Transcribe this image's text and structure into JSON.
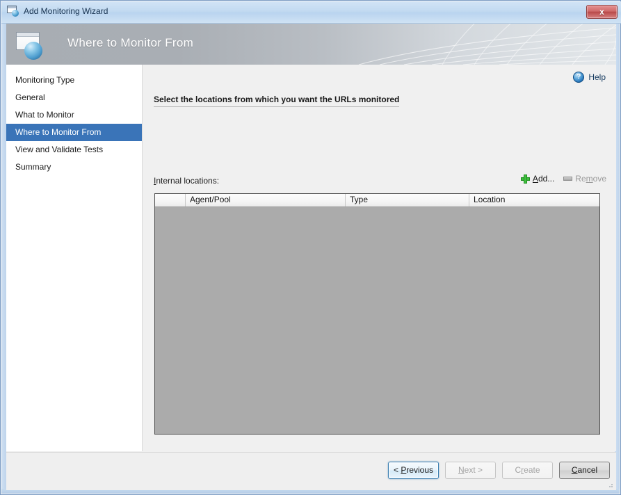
{
  "window": {
    "title": "Add Monitoring Wizard",
    "icon": "window-sphere-icon",
    "close_label": "x"
  },
  "banner": {
    "title": "Where to Monitor From",
    "icon": "window-sphere-icon"
  },
  "sidebar": {
    "items": [
      {
        "label": "Monitoring Type",
        "selected": false
      },
      {
        "label": "General",
        "selected": false
      },
      {
        "label": "What to Monitor",
        "selected": false
      },
      {
        "label": "Where to Monitor From",
        "selected": true
      },
      {
        "label": "View and Validate Tests",
        "selected": false
      },
      {
        "label": "Summary",
        "selected": false
      }
    ]
  },
  "content": {
    "help": {
      "label": "Help",
      "icon": "help-question-icon"
    },
    "instruction": "Select the locations from which you want the URLs monitored",
    "locations_label": {
      "accel": "I",
      "rest": "nternal locations:"
    },
    "toolbar": {
      "add": {
        "accel": "A",
        "rest": "dd...",
        "icon": "green-plus-icon",
        "enabled": true
      },
      "remove": {
        "accel": "m",
        "pre": "Re",
        "post": "ove",
        "icon": "remove-bar-icon",
        "enabled": false
      }
    },
    "grid": {
      "columns": [
        "",
        "Agent/Pool",
        "Type",
        "Location"
      ],
      "rows": []
    }
  },
  "footer": {
    "buttons": [
      {
        "name": "previous",
        "pre": "< ",
        "accel": "P",
        "post": "revious",
        "state": "focused"
      },
      {
        "name": "next",
        "pre": "",
        "accel": "N",
        "post": "ext >",
        "state": "disabled"
      },
      {
        "name": "create",
        "pre": "C",
        "accel": "r",
        "post": "eate",
        "state": "disabled"
      },
      {
        "name": "cancel",
        "pre": "",
        "accel": "C",
        "post": "ancel",
        "state": "hover"
      }
    ]
  },
  "colors": {
    "accent": "#3a74b8",
    "grid_body": "#ababab",
    "add_icon": "#3fbf3f",
    "close_button": "#b94a4a"
  }
}
